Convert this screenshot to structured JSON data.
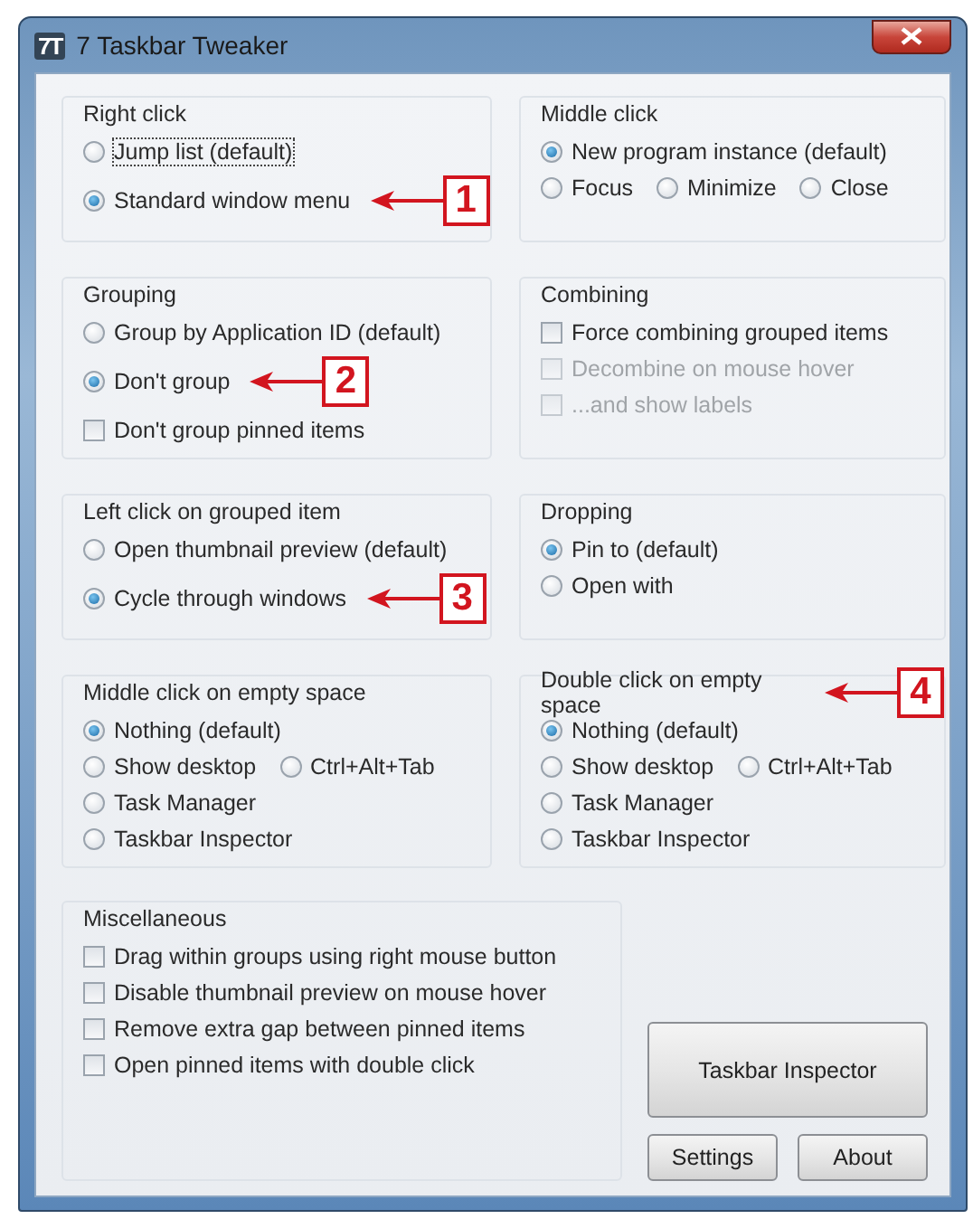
{
  "window": {
    "title": "7 Taskbar Tweaker",
    "icon_text": "7T"
  },
  "groups": [
    {
      "title": "Right click",
      "rows": [
        [
          {
            "kind": "radio",
            "label": "Jump list (default)",
            "selected": false,
            "focused": true,
            "disabled": false
          }
        ],
        [
          {
            "kind": "radio",
            "label": "Standard window menu",
            "selected": true,
            "focused": false,
            "disabled": false,
            "callout": "1"
          }
        ]
      ]
    },
    {
      "title": "Middle click",
      "rows": [
        [
          {
            "kind": "radio",
            "label": "New program instance (default)",
            "selected": true,
            "focused": false,
            "disabled": false
          }
        ],
        [
          {
            "kind": "radio",
            "label": "Focus",
            "selected": false,
            "focused": false,
            "disabled": false
          },
          {
            "kind": "radio",
            "label": "Minimize",
            "selected": false,
            "focused": false,
            "disabled": false
          },
          {
            "kind": "radio",
            "label": "Close",
            "selected": false,
            "focused": false,
            "disabled": false
          }
        ]
      ]
    },
    {
      "title": "Grouping",
      "rows": [
        [
          {
            "kind": "radio",
            "label": "Group by Application ID (default)",
            "selected": false,
            "focused": false,
            "disabled": false
          }
        ],
        [
          {
            "kind": "radio",
            "label": "Don't group",
            "selected": true,
            "focused": false,
            "disabled": false,
            "callout": "2"
          }
        ],
        [
          {
            "kind": "checkbox",
            "label": "Don't group pinned items",
            "checked": false,
            "focused": false,
            "disabled": false
          }
        ]
      ]
    },
    {
      "title": "Combining",
      "rows": [
        [
          {
            "kind": "checkbox",
            "label": "Force combining grouped items",
            "checked": false,
            "focused": false,
            "disabled": false
          }
        ],
        [
          {
            "kind": "checkbox",
            "label": "Decombine on mouse hover",
            "checked": false,
            "focused": false,
            "disabled": true
          }
        ],
        [
          {
            "kind": "checkbox",
            "label": "...and show labels",
            "checked": false,
            "focused": false,
            "disabled": true
          }
        ]
      ]
    },
    {
      "title": "Left click on grouped item",
      "rows": [
        [
          {
            "kind": "radio",
            "label": "Open thumbnail preview (default)",
            "selected": false,
            "focused": false,
            "disabled": false
          }
        ],
        [
          {
            "kind": "radio",
            "label": "Cycle through windows",
            "selected": true,
            "focused": false,
            "disabled": false,
            "callout": "3"
          }
        ]
      ]
    },
    {
      "title": "Dropping",
      "rows": [
        [
          {
            "kind": "radio",
            "label": "Pin to (default)",
            "selected": true,
            "focused": false,
            "disabled": false
          }
        ],
        [
          {
            "kind": "radio",
            "label": "Open with",
            "selected": false,
            "focused": false,
            "disabled": false
          }
        ]
      ]
    },
    {
      "title": "Middle click on empty space",
      "rows": [
        [
          {
            "kind": "radio",
            "label": "Nothing (default)",
            "selected": true,
            "focused": false,
            "disabled": false
          }
        ],
        [
          {
            "kind": "radio",
            "label": "Show desktop",
            "selected": false,
            "focused": false,
            "disabled": false
          },
          {
            "kind": "radio",
            "label": "Ctrl+Alt+Tab",
            "selected": false,
            "focused": false,
            "disabled": false
          }
        ],
        [
          {
            "kind": "radio",
            "label": "Task Manager",
            "selected": false,
            "focused": false,
            "disabled": false
          }
        ],
        [
          {
            "kind": "radio",
            "label": "Taskbar Inspector",
            "selected": false,
            "focused": false,
            "disabled": false
          }
        ]
      ]
    },
    {
      "title": "Double click on empty space",
      "title_callout": "4",
      "rows": [
        [
          {
            "kind": "radio",
            "label": "Nothing (default)",
            "selected": true,
            "focused": false,
            "disabled": false
          }
        ],
        [
          {
            "kind": "radio",
            "label": "Show desktop",
            "selected": false,
            "focused": false,
            "disabled": false
          },
          {
            "kind": "radio",
            "label": "Ctrl+Alt+Tab",
            "selected": false,
            "focused": false,
            "disabled": false
          }
        ],
        [
          {
            "kind": "radio",
            "label": "Task Manager",
            "selected": false,
            "focused": false,
            "disabled": false
          }
        ],
        [
          {
            "kind": "radio",
            "label": "Taskbar Inspector",
            "selected": false,
            "focused": false,
            "disabled": false
          }
        ]
      ]
    }
  ],
  "miscellaneous": {
    "title": "Miscellaneous",
    "rows": [
      [
        {
          "kind": "checkbox",
          "label": "Drag within groups using right mouse button",
          "checked": false,
          "focused": false,
          "disabled": false
        }
      ],
      [
        {
          "kind": "checkbox",
          "label": "Disable thumbnail preview on mouse hover",
          "checked": false,
          "focused": false,
          "disabled": false
        }
      ],
      [
        {
          "kind": "checkbox",
          "label": "Remove extra gap between pinned items",
          "checked": false,
          "focused": false,
          "disabled": false
        }
      ],
      [
        {
          "kind": "checkbox",
          "label": "Open pinned items with double click",
          "checked": false,
          "focused": false,
          "disabled": false
        }
      ]
    ]
  },
  "buttons": [
    {
      "kind": "large",
      "label": "Taskbar Inspector"
    },
    {
      "kind": "small",
      "label": "Settings"
    },
    {
      "kind": "small",
      "label": "About"
    }
  ]
}
